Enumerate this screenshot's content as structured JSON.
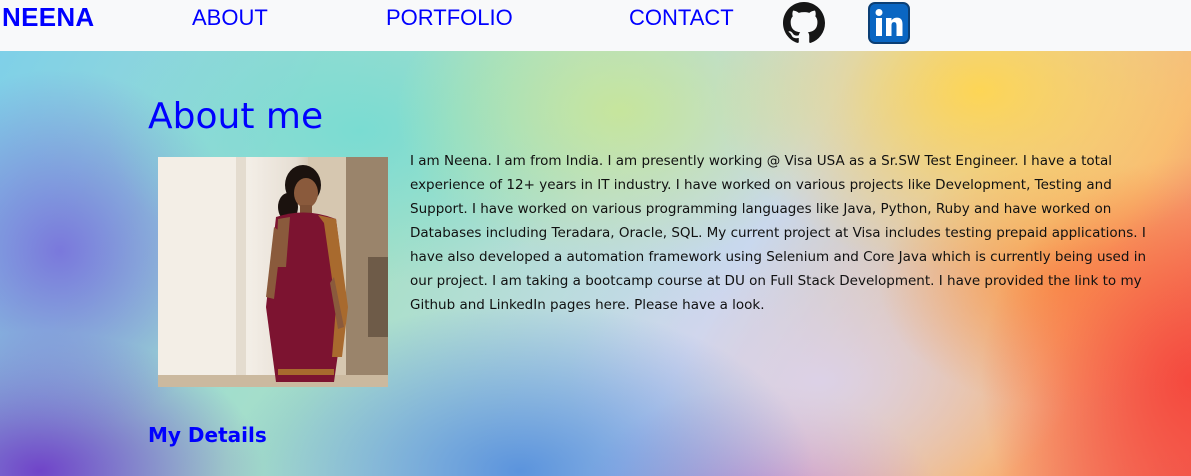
{
  "nav": {
    "brand": "NEENA",
    "links": [
      {
        "label": "ABOUT"
      },
      {
        "label": "PORTFOLIO"
      },
      {
        "label": "CONTACT"
      }
    ],
    "icons": [
      "github-icon",
      "linkedin-icon"
    ]
  },
  "about": {
    "title": "About me",
    "bio": "I am Neena. I am from India. I am presently working @ Visa USA as a Sr.SW Test Engineer. I have a total experience of 12+ years in IT industry. I have worked on various projects like Development, Testing and Support. I have worked on various programming languages like Java, Python, Ruby and have worked on Databases including Teradara, Oracle, SQL. My current project at Visa includes testing prepaid applications. I have also developed a automation framework using Selenium and Core Java which is currently being used in our project. I am taking a bootcamp course at DU on Full Stack Development. I have provided the link to my Github and LinkedIn pages here. Please have a look.",
    "details_heading": "My Details"
  },
  "colors": {
    "link": "#0000ff",
    "navbar_bg": "#f8f9fa",
    "linkedin_blue": "#0a66c2"
  }
}
